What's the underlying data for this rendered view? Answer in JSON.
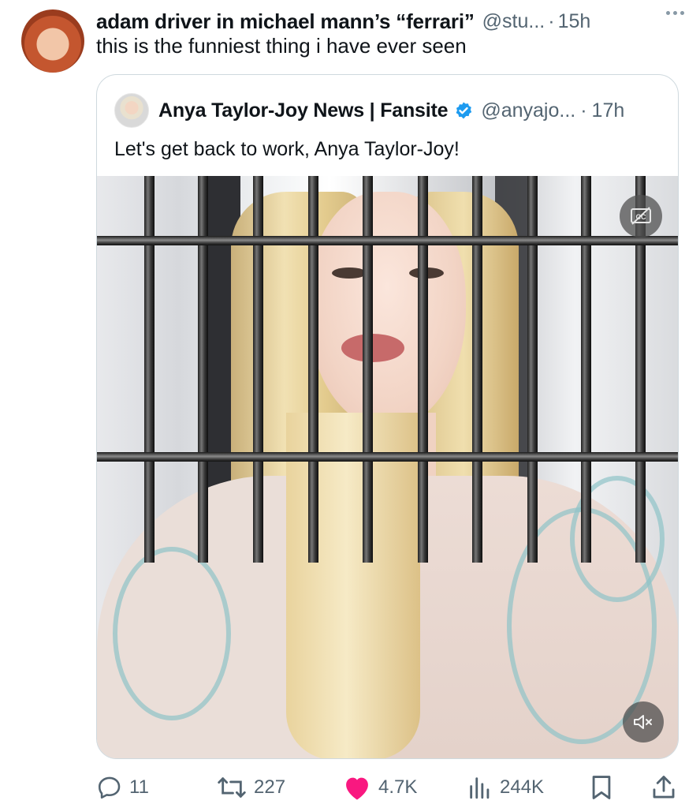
{
  "tweet": {
    "author_name": "adam driver in michael mann’s “ferrari”",
    "author_handle": "@stu...",
    "separator": "·",
    "time": "15h",
    "text": "this is the funniest thing i have ever seen"
  },
  "quoted_tweet": {
    "author_name": "Anya Taylor-Joy News | Fansite",
    "author_handle": "@anyajo...",
    "separator": "·",
    "time": "17h",
    "text": "Let's get back to work, Anya Taylor-Joy!",
    "verified_color": "#1d9bf0"
  },
  "actions": {
    "replies": "11",
    "retweets": "227",
    "likes": "4.7K",
    "views": "244K"
  },
  "colors": {
    "like": "#f91880",
    "muted_text": "#536471",
    "border": "#cfd9de"
  },
  "icons": [
    "more-icon",
    "verified-icon",
    "captions-icon",
    "mute-icon",
    "reply-icon",
    "retweet-icon",
    "like-icon",
    "views-icon",
    "bookmark-icon",
    "share-icon"
  ]
}
